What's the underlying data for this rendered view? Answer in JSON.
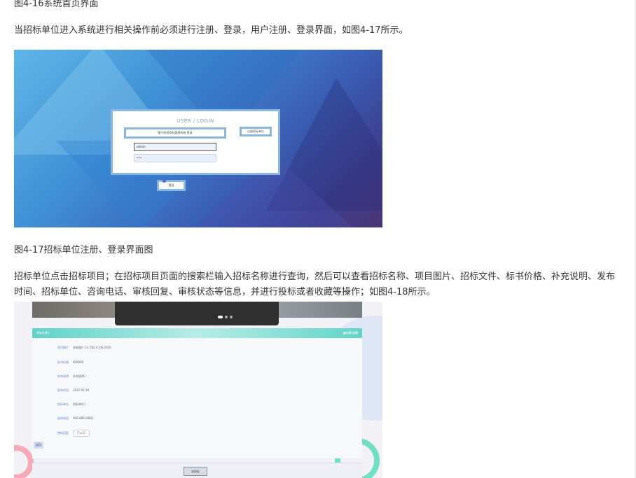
{
  "text": {
    "fig16_caption": "图4-16系统首页界面",
    "intro": "当招标单位进入系统进行相关操作前必须进行注册、登录，用户注册、登录界面，如图4-17所示。",
    "fig17_caption": "图4-17招标单位注册、登录界面图",
    "body": "招标单位点击招标项目；在招标项目页面的搜索栏输入招标名称进行查询，然后可以查看招标名称、项目图片、招标文件、标书价格、补充说明、发布时间、招标单位、咨询电话、审核回复、审核状态等信息，并进行投标或者收藏等操作；如图4-18所示。"
  },
  "login_shot": {
    "title": "USER / LOGIN",
    "system_name": "基于的招投标管理系统 登录",
    "username_value": "admin",
    "password_value": "•••",
    "register_button": "注册招标单位",
    "login_button": "登录"
  },
  "detail_shot": {
    "panel_title": "招标名称1",
    "panel_action": "●收藏(收藏",
    "rows": [
      {
        "key": "项目图片",
        "value": "多轮图片 14.2资14.2资·2020"
      },
      {
        "key": "标书价格",
        "value": "666666"
      },
      {
        "key": "补充说明",
        "value": "补充说明1"
      },
      {
        "key": "发布时间",
        "value": "2022-02-16"
      },
      {
        "key": "招标单位",
        "value": "招标单位1"
      },
      {
        "key": "咨询电话",
        "value": "000-88618881"
      },
      {
        "key": "审核回复",
        "value": "已公示"
      }
    ],
    "back_label": "返回",
    "bid_button": "去投标"
  }
}
